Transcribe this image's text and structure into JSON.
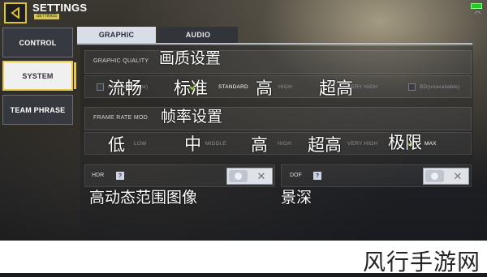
{
  "header": {
    "title": "SETTINGS",
    "subtitle_tag": "SETTINGS"
  },
  "nav": {
    "items": [
      {
        "label": "CONTROL"
      },
      {
        "label": "SYSTEM",
        "active": true
      },
      {
        "label": "TEAM PHRASE"
      }
    ]
  },
  "tabs": [
    {
      "label": "GRAPHIC",
      "active": true
    },
    {
      "label": "AUDIO"
    }
  ],
  "graphic_quality": {
    "label": "GRAPHIC QUALITY",
    "label_cn": "画质设置",
    "options": [
      {
        "label": "BD(unavailable)",
        "cn": "流畅"
      },
      {
        "label": "STANDARD",
        "cn": "标准",
        "selected": true
      },
      {
        "label": "HIGH",
        "cn": "高"
      },
      {
        "label": "VERY HIGH",
        "cn": "超高"
      },
      {
        "label": "BD(unavailable)"
      }
    ]
  },
  "frame_rate": {
    "label": "FRAME RATE MOD",
    "label_cn": "帧率设置",
    "options": [
      {
        "label": "LOW",
        "cn": "低"
      },
      {
        "label": "MIDDLE",
        "cn": "中"
      },
      {
        "label": "HIGH",
        "cn": "高"
      },
      {
        "label": "VERY HIGH",
        "cn": "超高"
      },
      {
        "label": "MAX",
        "cn": "极限",
        "selected": true
      }
    ]
  },
  "hdr": {
    "label": "HDR",
    "help": "?",
    "label_cn": "高动态范围图像",
    "enabled": false
  },
  "dof": {
    "label": "DOF",
    "help": "?",
    "label_cn": "景深",
    "enabled": false
  },
  "watermark": "风行手游网",
  "colors": {
    "accent": "#e8c84a",
    "check": "#9fd83a",
    "tab_active": "#d8dde8"
  }
}
